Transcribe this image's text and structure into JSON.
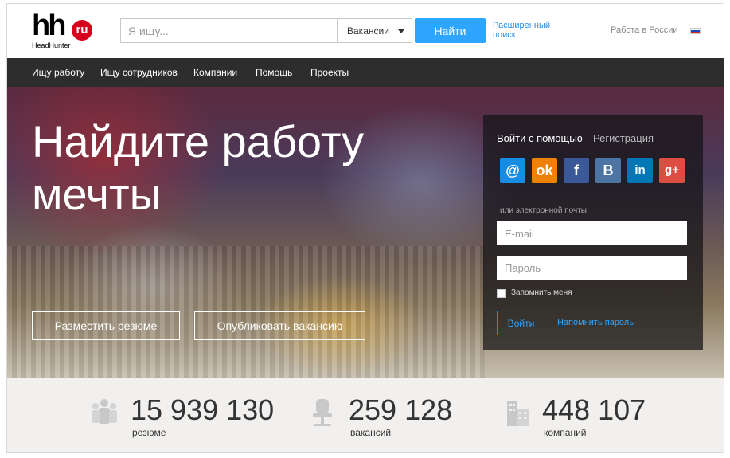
{
  "header": {
    "logo_text": "hh",
    "logo_badge": "ru",
    "logo_subtitle": "HeadHunter",
    "search_placeholder": "Я ищу...",
    "search_type": "Вакансии",
    "search_button": "Найти",
    "advanced_search": "Расширенный поиск",
    "region": "Работа в России",
    "flag_icon": "russia-flag-icon"
  },
  "nav": {
    "items": [
      "Ищу работу",
      "Ищу сотрудников",
      "Компании",
      "Помощь",
      "Проекты"
    ]
  },
  "hero": {
    "title": "Найдите работу мечты",
    "post_resume_button": "Разместить резюме",
    "post_vacancy_button": "Опубликовать вакансию"
  },
  "login": {
    "tab_login": "Войти с помощью",
    "tab_register": "Регистрация",
    "social_icons": [
      "mail-ru-icon",
      "odnoklassniki-icon",
      "facebook-icon",
      "vkontakte-icon",
      "linkedin-icon",
      "google-plus-icon"
    ],
    "social_glyphs": [
      "@",
      "ok",
      "f",
      "B",
      "in",
      "g+"
    ],
    "or_email": "или электронной почты",
    "email_placeholder": "E-mail",
    "password_placeholder": "Пароль",
    "remember_me": "Запомнить меня",
    "login_button": "Войти",
    "remind_password": "Напомнить пароль"
  },
  "stats": [
    {
      "icon": "people-icon",
      "number": "15 939 130",
      "label": "резюме"
    },
    {
      "icon": "office-chair-icon",
      "number": "259 128",
      "label": "вакансий"
    },
    {
      "icon": "buildings-icon",
      "number": "448 107",
      "label": "компаний"
    }
  ],
  "colors": {
    "accent": "#2ea6ff",
    "brand_red": "#d6001c",
    "nav_bg": "#2d2d2d",
    "stats_bg": "#f1f0ee"
  }
}
